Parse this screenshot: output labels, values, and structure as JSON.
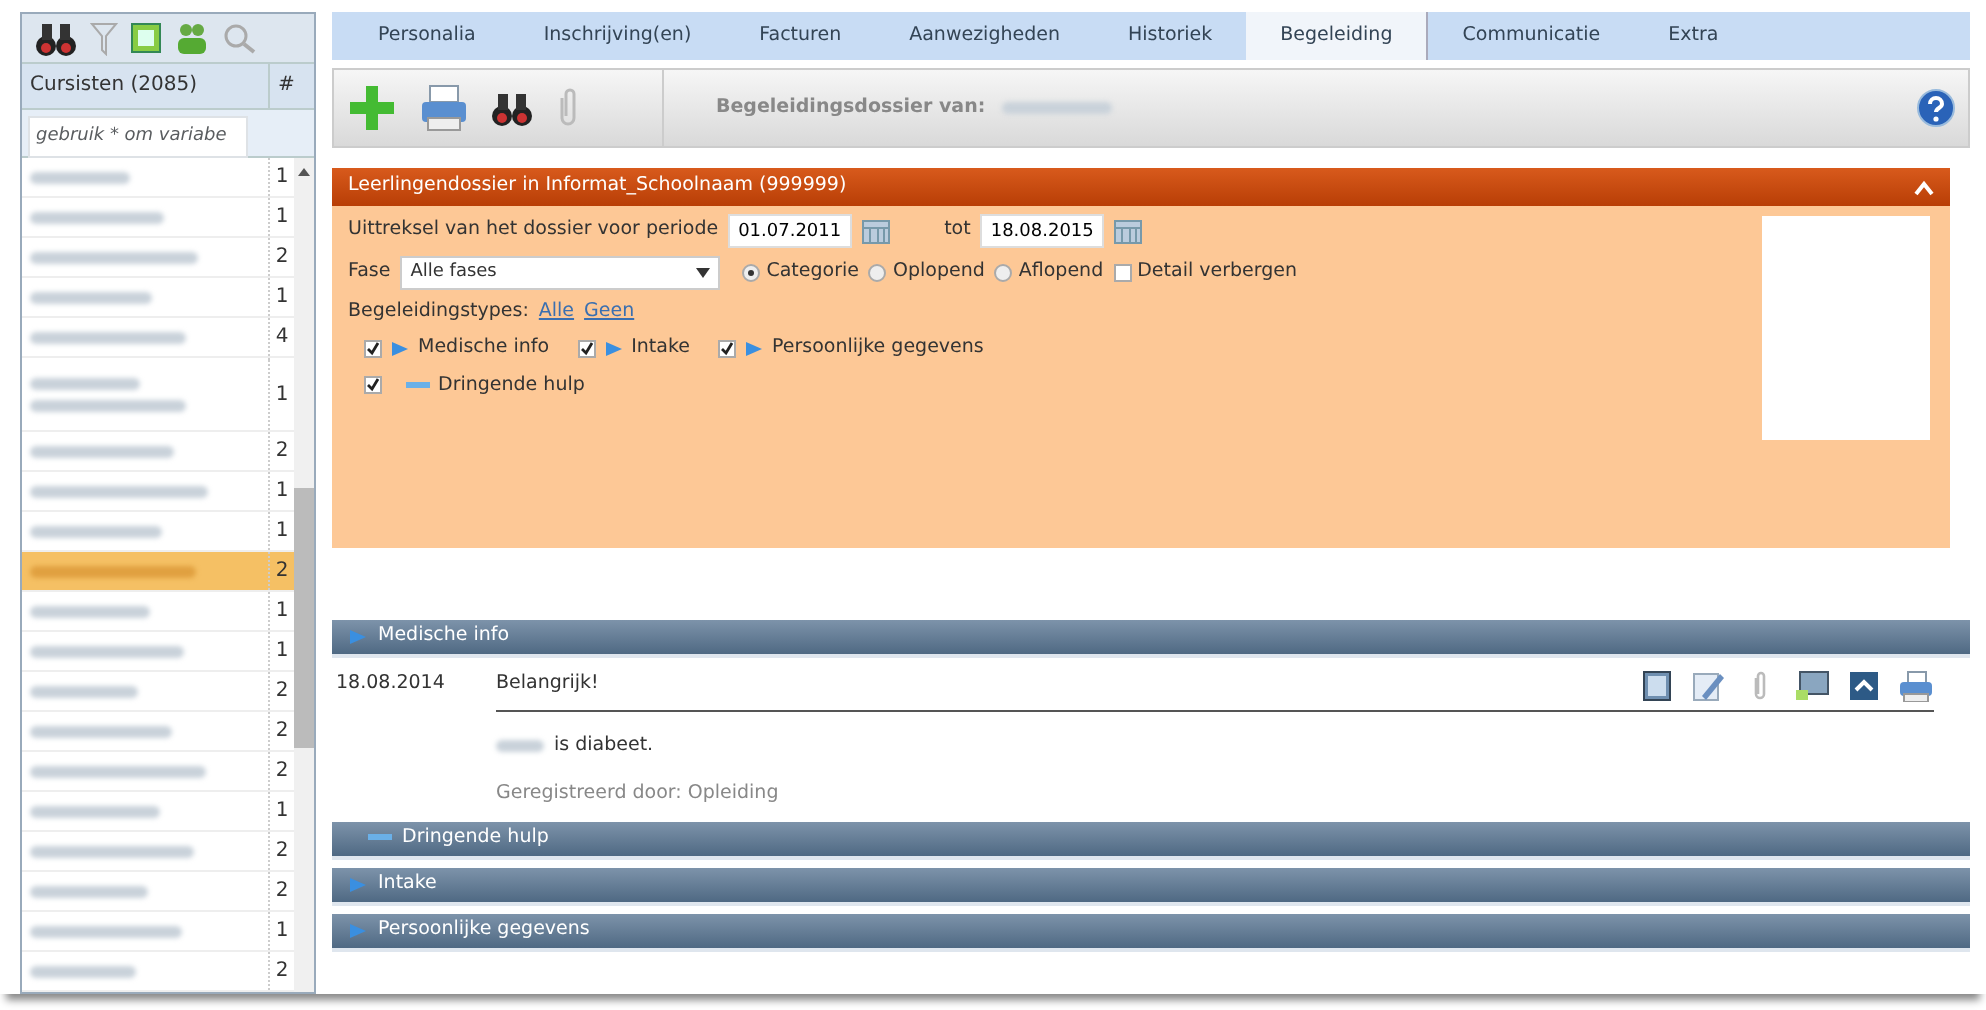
{
  "sidebar": {
    "header": "Cursisten (2085)",
    "count_header": "#",
    "search": {
      "placeholder": "gebruik * om variabe"
    },
    "rows": [
      {
        "count": "1",
        "selected": false,
        "kind": "single"
      },
      {
        "count": "1",
        "selected": false,
        "kind": "single"
      },
      {
        "count": "2",
        "selected": false,
        "kind": "single"
      },
      {
        "count": "1",
        "selected": false,
        "kind": "single"
      },
      {
        "count": "4",
        "selected": false,
        "kind": "single"
      },
      {
        "count": "1",
        "selected": false,
        "kind": "double"
      },
      {
        "count": "2",
        "selected": false,
        "kind": "single"
      },
      {
        "count": "1",
        "selected": false,
        "kind": "single"
      },
      {
        "count": "1",
        "selected": false,
        "kind": "single"
      },
      {
        "count": "2",
        "selected": true,
        "kind": "single"
      },
      {
        "count": "1",
        "selected": false,
        "kind": "single"
      },
      {
        "count": "1",
        "selected": false,
        "kind": "single"
      },
      {
        "count": "2",
        "selected": false,
        "kind": "single"
      },
      {
        "count": "2",
        "selected": false,
        "kind": "single"
      },
      {
        "count": "2",
        "selected": false,
        "kind": "single"
      },
      {
        "count": "1",
        "selected": false,
        "kind": "single"
      },
      {
        "count": "2",
        "selected": false,
        "kind": "single"
      },
      {
        "count": "2",
        "selected": false,
        "kind": "single"
      },
      {
        "count": "1",
        "selected": false,
        "kind": "single"
      },
      {
        "count": "2",
        "selected": false,
        "kind": "single"
      }
    ]
  },
  "tabs": [
    {
      "label": "Personalia",
      "selected": false
    },
    {
      "label": "Inschrijving(en)",
      "selected": false
    },
    {
      "label": "Facturen",
      "selected": false
    },
    {
      "label": "Aanwezigheden",
      "selected": false
    },
    {
      "label": "Historiek",
      "selected": false
    },
    {
      "label": "Begeleiding",
      "selected": true
    },
    {
      "label": "Communicatie",
      "selected": false
    },
    {
      "label": "Extra",
      "selected": false
    }
  ],
  "toolbar": {
    "title": "Begeleidingsdossier van:"
  },
  "panel": {
    "title": "Leerlingendossier in Informat_Schoolnaam (999999)",
    "expanded": true,
    "period_label": "Uittreksel van het dossier voor periode",
    "from": "01.07.2011",
    "to_label": "tot",
    "to": "18.08.2015",
    "fase_label": "Fase",
    "fase_value": "Alle fases",
    "radios": [
      {
        "label": "Categorie",
        "selected": true
      },
      {
        "label": "Oplopend",
        "selected": false
      },
      {
        "label": "Aflopend",
        "selected": false
      }
    ],
    "detail": {
      "label": "Detail verbergen",
      "checked": false
    },
    "types_label": "Begeleidingstypes:",
    "links": [
      "Alle",
      "Geen"
    ],
    "type_lines": [
      [
        {
          "label": "Medische info",
          "checked": true,
          "kind": "arrow"
        },
        {
          "label": "Intake",
          "checked": true,
          "kind": "arrow"
        },
        {
          "label": "Persoonlijke gegevens",
          "checked": true,
          "kind": "arrow"
        }
      ],
      [
        {
          "label": "Dringende hulp",
          "checked": true,
          "kind": "dash"
        }
      ]
    ]
  },
  "sections": [
    {
      "title": "Medische info",
      "kind": "arrow",
      "entries": [
        {
          "date": "18.08.2014",
          "title": "Belangrijk!",
          "text": "is diabeet.",
          "footer": "Geregistreerd door: Opleiding"
        }
      ]
    },
    {
      "title": "Dringende hulp",
      "kind": "dash"
    },
    {
      "title": "Intake",
      "kind": "arrow"
    },
    {
      "title": "Persoonlijke gegevens",
      "kind": "arrow"
    }
  ]
}
